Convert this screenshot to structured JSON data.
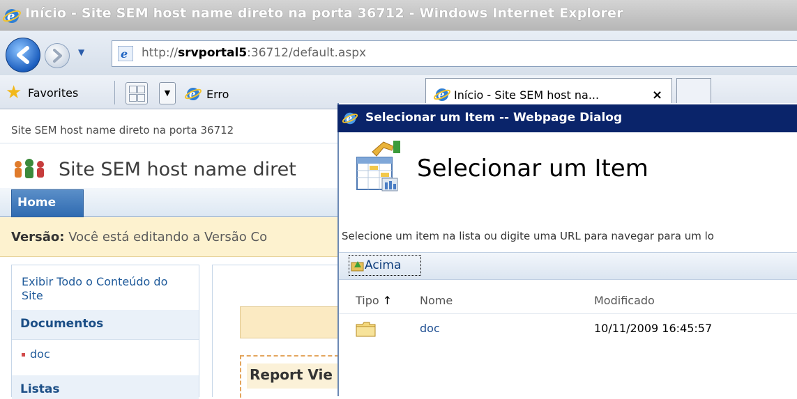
{
  "browser": {
    "window_title": "Início - Site SEM host name direto na porta 36712 - Windows Internet Explorer",
    "address": {
      "prefix": "http://",
      "host": "srvportal5",
      "suffix": ":36712/default.aspx"
    },
    "favorites_label": "Favorites",
    "tabs": [
      {
        "label": "Erro",
        "active": false
      },
      {
        "label": "Início - Site SEM host na...",
        "active": true
      },
      {
        "label": "",
        "active": false
      }
    ],
    "tab_close_glyph": "×"
  },
  "sharepoint": {
    "site_breadcrumb": "Site SEM host name direto na porta 36712",
    "site_title": "Site SEM host name diret",
    "nav_home": "Home",
    "version_label": "Versão:",
    "version_text": "Você está editando a Versão Co",
    "left_nav": {
      "view_all": "Exibir Todo o Conteúdo do Site",
      "documents_heading": "Documentos",
      "documents_items": [
        "doc"
      ],
      "lists_heading": "Listas"
    },
    "report_label": "Report Vie"
  },
  "dialog": {
    "window_title": "Selecionar um Item -- Webpage Dialog",
    "heading": "Selecionar um Item",
    "instruction": "Selecione um item na lista ou digite uma URL para navegar para um lo",
    "up_button": "Acima",
    "columns": {
      "type": "Tipo",
      "type_sort_glyph": "↑",
      "name": "Nome",
      "modified": "Modificado"
    },
    "rows": [
      {
        "type_icon": "folder-icon",
        "name": "doc",
        "modified": "10/11/2009 16:45:57"
      }
    ]
  },
  "colors": {
    "dialog_title_bg": "#0a246a",
    "sp_home_tab": "#2f6bb1",
    "version_bar": "#fdf2cf",
    "link": "#1f5a9a"
  }
}
